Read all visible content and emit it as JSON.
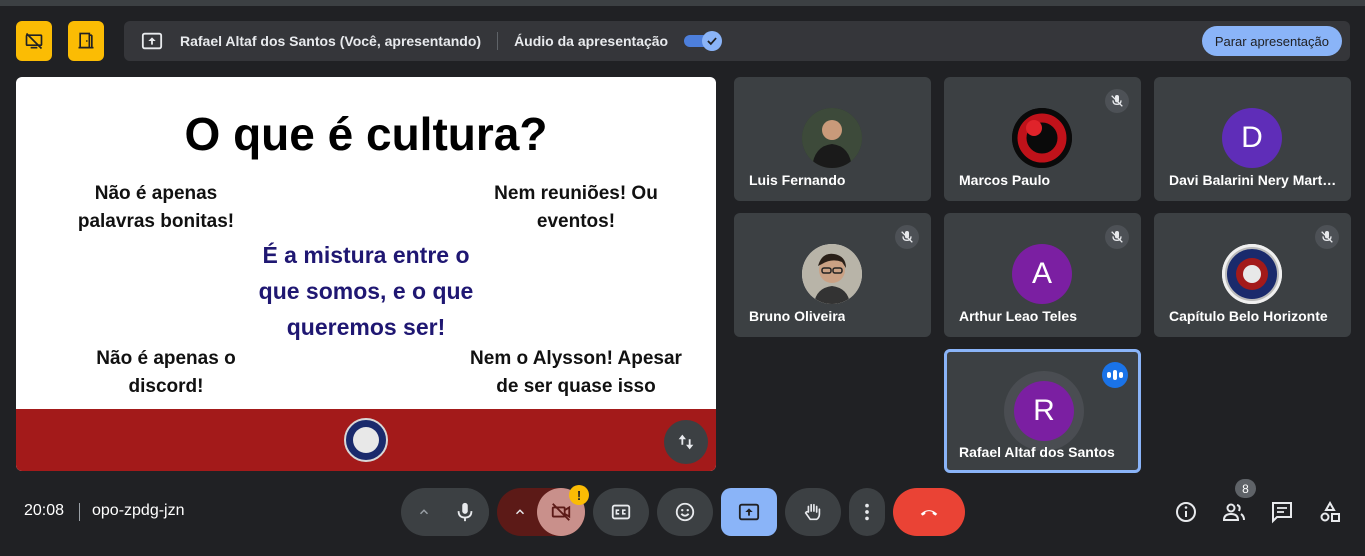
{
  "top_left": {
    "presentation_layout_icon": "screen-off-icon",
    "door_icon": "door-icon"
  },
  "presenting_bar": {
    "icon": "present-to-all-icon",
    "presenter_text": "Rafael Altaf dos Santos (Você, apresentando)",
    "audio_label": "Áudio da apresentação",
    "audio_toggle_on": true,
    "stop_button": "Parar apresentação",
    "accent": "#8ab4f8"
  },
  "slide": {
    "title": "O que é cultura?",
    "top_left_line1": "Não é apenas",
    "top_left_line2": "palavras bonitas!",
    "top_right_line1": "Nem reuniões! Ou",
    "top_right_line2": "eventos!",
    "center_line1": "É a mistura entre o",
    "center_line2": "que somos, e o que",
    "center_line3": "queremos ser!",
    "bottom_left_line1": "Não é apenas o",
    "bottom_left_line2": "discord!",
    "bottom_right_line1": "Nem o Alysson! Apesar",
    "bottom_right_line2": "de ser quase isso",
    "footer_color": "#a31a1a",
    "center_color": "#1f1772"
  },
  "participants": [
    {
      "name": "Luis Fernando",
      "avatar": "photo",
      "muted": false
    },
    {
      "name": "Marcos Paulo",
      "avatar": "photo",
      "muted": true
    },
    {
      "name": "Davi Balarini Nery Mart…",
      "avatar": "D",
      "avatar_color": "#5f2db8",
      "muted": false
    },
    {
      "name": "Bruno Oliveira",
      "avatar": "photo",
      "muted": true
    },
    {
      "name": "Arthur Leao Teles",
      "avatar": "A",
      "avatar_color": "#7b1fa2",
      "muted": true
    },
    {
      "name": "Capítulo Belo Horizonte",
      "avatar": "logo",
      "muted": true
    },
    {
      "name": "Rafael Altaf dos Santos",
      "avatar": "R",
      "avatar_color": "#7b1fa2",
      "speaking": true
    }
  ],
  "bottom_bar": {
    "time": "20:08",
    "meeting_code": "opo-zpdg-jzn",
    "camera_warning": "!",
    "participants_count": "8",
    "controls": [
      "mic-icon",
      "camera-off-icon",
      "captions-icon",
      "emoji-icon",
      "present-icon",
      "raise-hand-icon",
      "more-options-icon",
      "end-call-icon"
    ],
    "right_icons": [
      "info-icon",
      "people-icon",
      "chat-icon",
      "activities-icon"
    ],
    "end_call_color": "#ea4335"
  }
}
